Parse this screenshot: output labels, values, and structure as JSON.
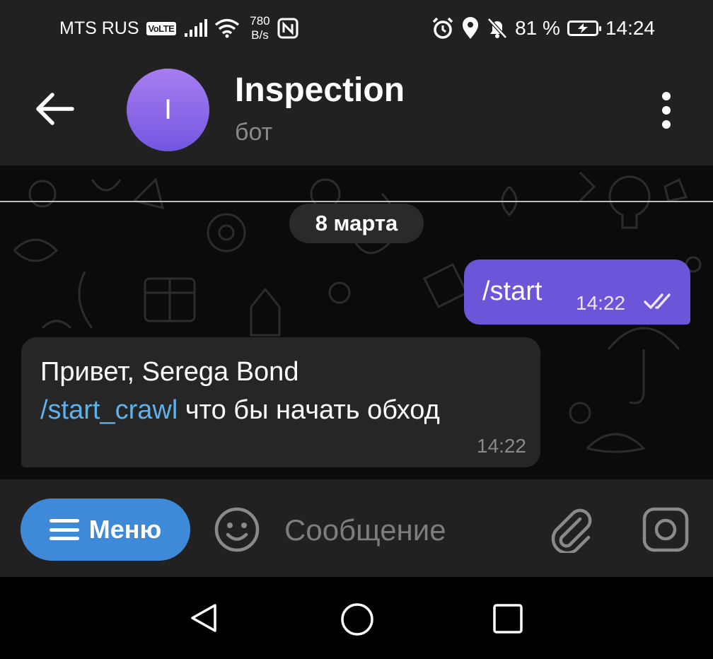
{
  "status_bar": {
    "carrier": "MTS RUS",
    "volte": "VoLTE",
    "speed_value": "780",
    "speed_unit": "B/s",
    "battery_percent": "81 %",
    "time": "14:24",
    "icons": [
      "signal-icon",
      "wifi-icon",
      "nfc-icon",
      "alarm-icon",
      "location-icon",
      "mute-icon",
      "battery-charging-icon"
    ]
  },
  "header": {
    "avatar_letter": "I",
    "title": "Inspection",
    "subtitle": "бот",
    "colors": {
      "avatar_top": "#a77ef0",
      "avatar_bottom": "#7356e0"
    }
  },
  "chat": {
    "date_label": "8 марта",
    "outgoing": {
      "text": "/start",
      "time": "14:22",
      "status": "read",
      "color": "#6c55d8"
    },
    "incoming": {
      "line1": "Привет, Serega Bond",
      "command": "/start_crawl",
      "line2_rest": " что бы начать обход",
      "time": "14:22",
      "link_color": "#5fb1ec"
    }
  },
  "input_bar": {
    "menu_label": "Меню",
    "menu_color": "#3e8ad8",
    "placeholder": "Сообщение"
  },
  "nav_bar": {
    "icons": [
      "nav-back-icon",
      "nav-home-icon",
      "nav-recent-icon"
    ]
  }
}
